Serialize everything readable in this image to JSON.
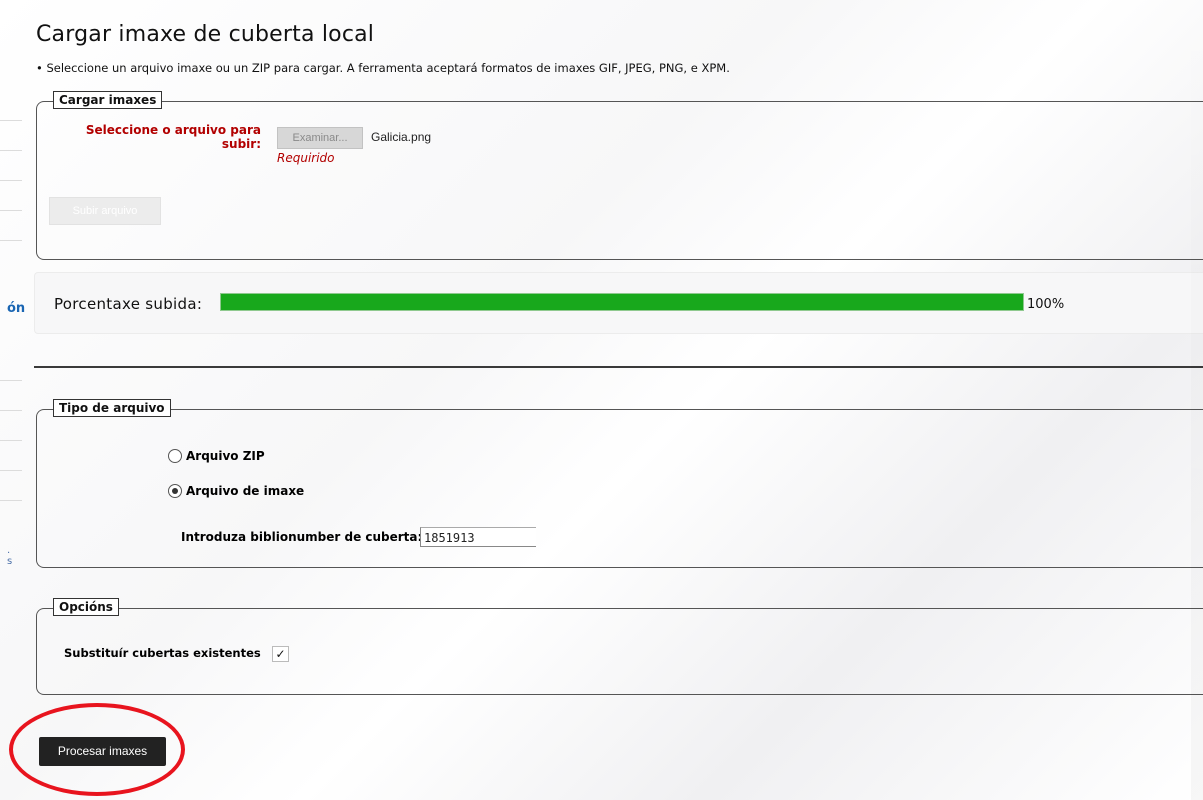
{
  "page": {
    "title": "Cargar imaxe de cuberta local",
    "hint": "• Seleccione un arquivo imaxe ou un ZIP para cargar. A ferramenta aceptará formatos de imaxes GIF, JPEG, PNG, e XPM."
  },
  "sidebar_fragment": {
    "link_text": "ón",
    "dot_a": ".",
    "dot_b": "s"
  },
  "upload_section": {
    "legend": "Cargar imaxes",
    "file_label": "Seleccione o arquivo para subir:",
    "browse_label": "Examinar...",
    "file_name": "Galicia.png",
    "required_text": "Requirido",
    "upload_button": "Subir arquivo"
  },
  "progress": {
    "label": "Porcentaxe subida:",
    "percent_text": "100%",
    "fraction": 1.0,
    "fill_color": "#18a81c"
  },
  "file_type_section": {
    "legend": "Tipo de arquivo",
    "options": [
      {
        "label": "Arquivo ZIP",
        "checked": false
      },
      {
        "label": "Arquivo de imaxe",
        "checked": true
      }
    ],
    "biblio_label": "Introduza biblionumber de cuberta:",
    "biblio_value": "1851913"
  },
  "options_section": {
    "legend": "Opcións",
    "replace_label": "Substituír cubertas existentes",
    "replace_checked": true,
    "check_glyph": "✓"
  },
  "actions": {
    "process_button": "Procesar imaxes",
    "highlight_color": "#e8141e"
  }
}
